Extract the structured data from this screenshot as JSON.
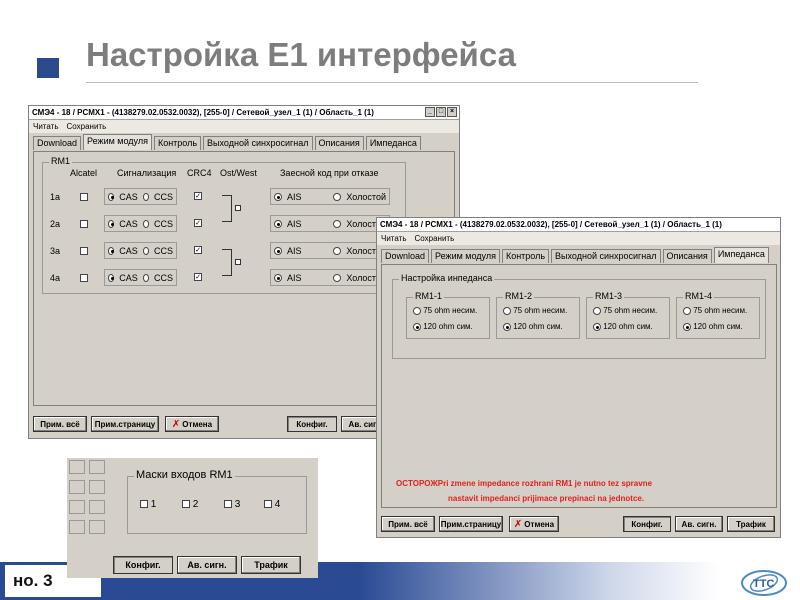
{
  "slide": {
    "title": "Настройка Е1 интерфейса",
    "slide_number": "но. 3"
  },
  "window1": {
    "title": "СМЭ4 - 18 / PCMX1 - (4138279.02.0532.0032), [255-0] / Сетевой_узел_1 (1) / Область_1 (1)",
    "menu": [
      "Читать",
      "Сохранить"
    ],
    "tabs": [
      "Download",
      "Режим модуля",
      "Контроль",
      "Выходной синхросигнал",
      "Описания",
      "Импеданса"
    ],
    "active_tab": "Режим модуля",
    "group_label": "RM1",
    "headers": [
      "Alcatel",
      "Сигнализация",
      "CRC4",
      "Ost/West",
      "Заесной код при отказе"
    ],
    "rows": [
      {
        "label": "1a",
        "alcatel": false,
        "sig_cas": "CAS",
        "sig_ccs": "CCS",
        "crc4": true,
        "code_ais": "AIS",
        "code_idle": "Холостой"
      },
      {
        "label": "2a",
        "alcatel": false,
        "sig_cas": "CAS",
        "sig_ccs": "CCS",
        "crc4": true,
        "code_ais": "AIS",
        "code_idle": "Холостой"
      },
      {
        "label": "3a",
        "alcatel": false,
        "sig_cas": "CAS",
        "sig_ccs": "CCS",
        "crc4": true,
        "code_ais": "AIS",
        "code_idle": "Холостой"
      },
      {
        "label": "4a",
        "alcatel": false,
        "sig_cas": "CAS",
        "sig_ccs": "CCS",
        "crc4": true,
        "code_ais": "AIS",
        "code_idle": "Холостой"
      }
    ],
    "buttons": {
      "apply_all": "Прим. всё",
      "apply_page": "Прим.страницу",
      "cancel": "Отмена",
      "config": "Конфиг.",
      "alarm": "Ав. сигн."
    }
  },
  "window2": {
    "title": "СМЭ4 - 18 / PCMX1 - (4138279.02.0532.0032), [255-0] / Сетевой_узел_1 (1) / Область_1 (1)",
    "menu": [
      "Читать",
      "Сохранить"
    ],
    "tabs": [
      "Download",
      "Режим модуля",
      "Контроль",
      "Выходной синхросигнал",
      "Описания",
      "Импеданса"
    ],
    "active_tab": "Импеданса",
    "group_label": "Настройка инпеданса",
    "modules": [
      {
        "label": "RM1-1",
        "opt1": "75 ohm несим.",
        "opt2": "120 ohm сим."
      },
      {
        "label": "RM1-2",
        "opt1": "75 ohm несим.",
        "opt2": "120 ohm сим."
      },
      {
        "label": "RM1-3",
        "opt1": "75 ohm несим.",
        "opt2": "120 ohm сим."
      },
      {
        "label": "RM1-4",
        "opt1": "75 ohm несим.",
        "opt2": "120 ohm сим."
      }
    ],
    "warning_line1": "OCTOPOЖPri zmene impedance rozhrani RM1 je nutno tez spravne",
    "warning_line2": "nastavit impedanci prijimace prepinaci na jednotce.",
    "buttons": {
      "apply_all": "Прим. всё",
      "apply_page": "Прим.страницу",
      "cancel": "Отмена",
      "config": "Конфиг.",
      "alarm": "Ав. сигн.",
      "traffic": "Трафик"
    }
  },
  "window3": {
    "group_label": "Маски входов RM1",
    "masks": [
      "1",
      "2",
      "3",
      "4"
    ],
    "buttons": {
      "config": "Конфиг.",
      "alarm": "Ав. сигн.",
      "traffic": "Трафик"
    }
  },
  "colors": {
    "title_gray": "#7d7d7d",
    "footer_blue": "#2a4b94",
    "warning_red": "#e02020",
    "cancel_x_red": "#c00000"
  }
}
